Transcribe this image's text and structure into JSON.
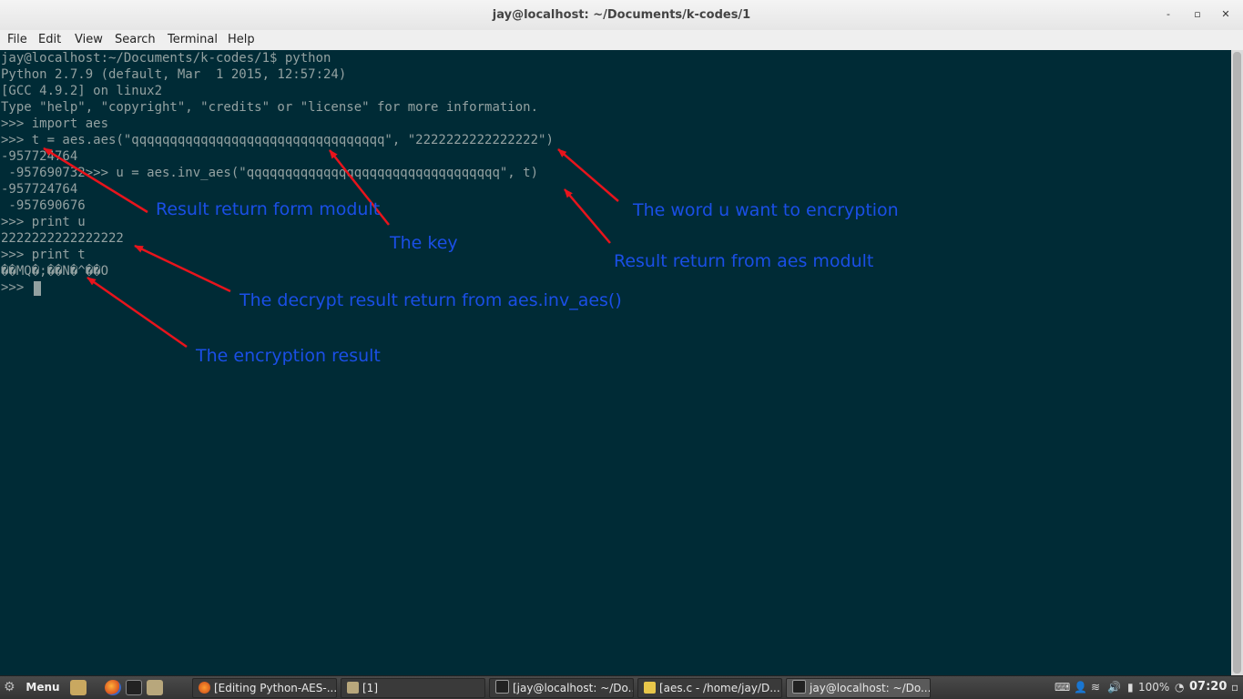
{
  "window": {
    "title": "jay@localhost: ~/Documents/k-codes/1",
    "minimize": "-",
    "maximize": "▫",
    "close": "✕"
  },
  "menubar": {
    "items": [
      "File",
      "Edit",
      "View",
      "Search",
      "Terminal",
      "Help"
    ]
  },
  "terminal": {
    "lines": [
      "jay@localhost:~/Documents/k-codes/1$ python",
      "Python 2.7.9 (default, Mar  1 2015, 12:57:24)",
      "[GCC 4.9.2] on linux2",
      "Type \"help\", \"copyright\", \"credits\" or \"license\" for more information.",
      ">>> import aes",
      ">>> t = aes.aes(\"qqqqqqqqqqqqqqqqqqqqqqqqqqqqqqqqq\", \"2222222222222222\")",
      "-957724764",
      " -957690732>>> u = aes.inv_aes(\"qqqqqqqqqqqqqqqqqqqqqqqqqqqqqqqqq\", t)",
      "-957724764",
      " -957690676",
      ">>> print u",
      "2222222222222222",
      ">>> print t",
      "��MQ�;��N�^��O",
      ">>> "
    ]
  },
  "annotations": {
    "result_return_form_modult": "Result return form modult",
    "the_key": "The key",
    "word_to_encrypt": "The word u want to encryption",
    "result_from_aes_modult": "Result return from aes modult",
    "decrypt_result": "The decrypt result return from aes.inv_aes()",
    "encryption_result": "The encryption result",
    "annotation_color": "#1a4fe6",
    "arrow_color": "#e8141c"
  },
  "taskbar": {
    "menu_label": "Menu",
    "tasks": [
      "[Editing Python-AES-...",
      "[1]",
      "[jay@localhost: ~/Do...",
      "[aes.c - /home/jay/D...",
      "jay@localhost: ~/Do..."
    ],
    "battery": "100%",
    "clock": "07:20"
  },
  "colors": {
    "terminal_bg": "#002b36",
    "terminal_fg": "#93a1a1"
  }
}
